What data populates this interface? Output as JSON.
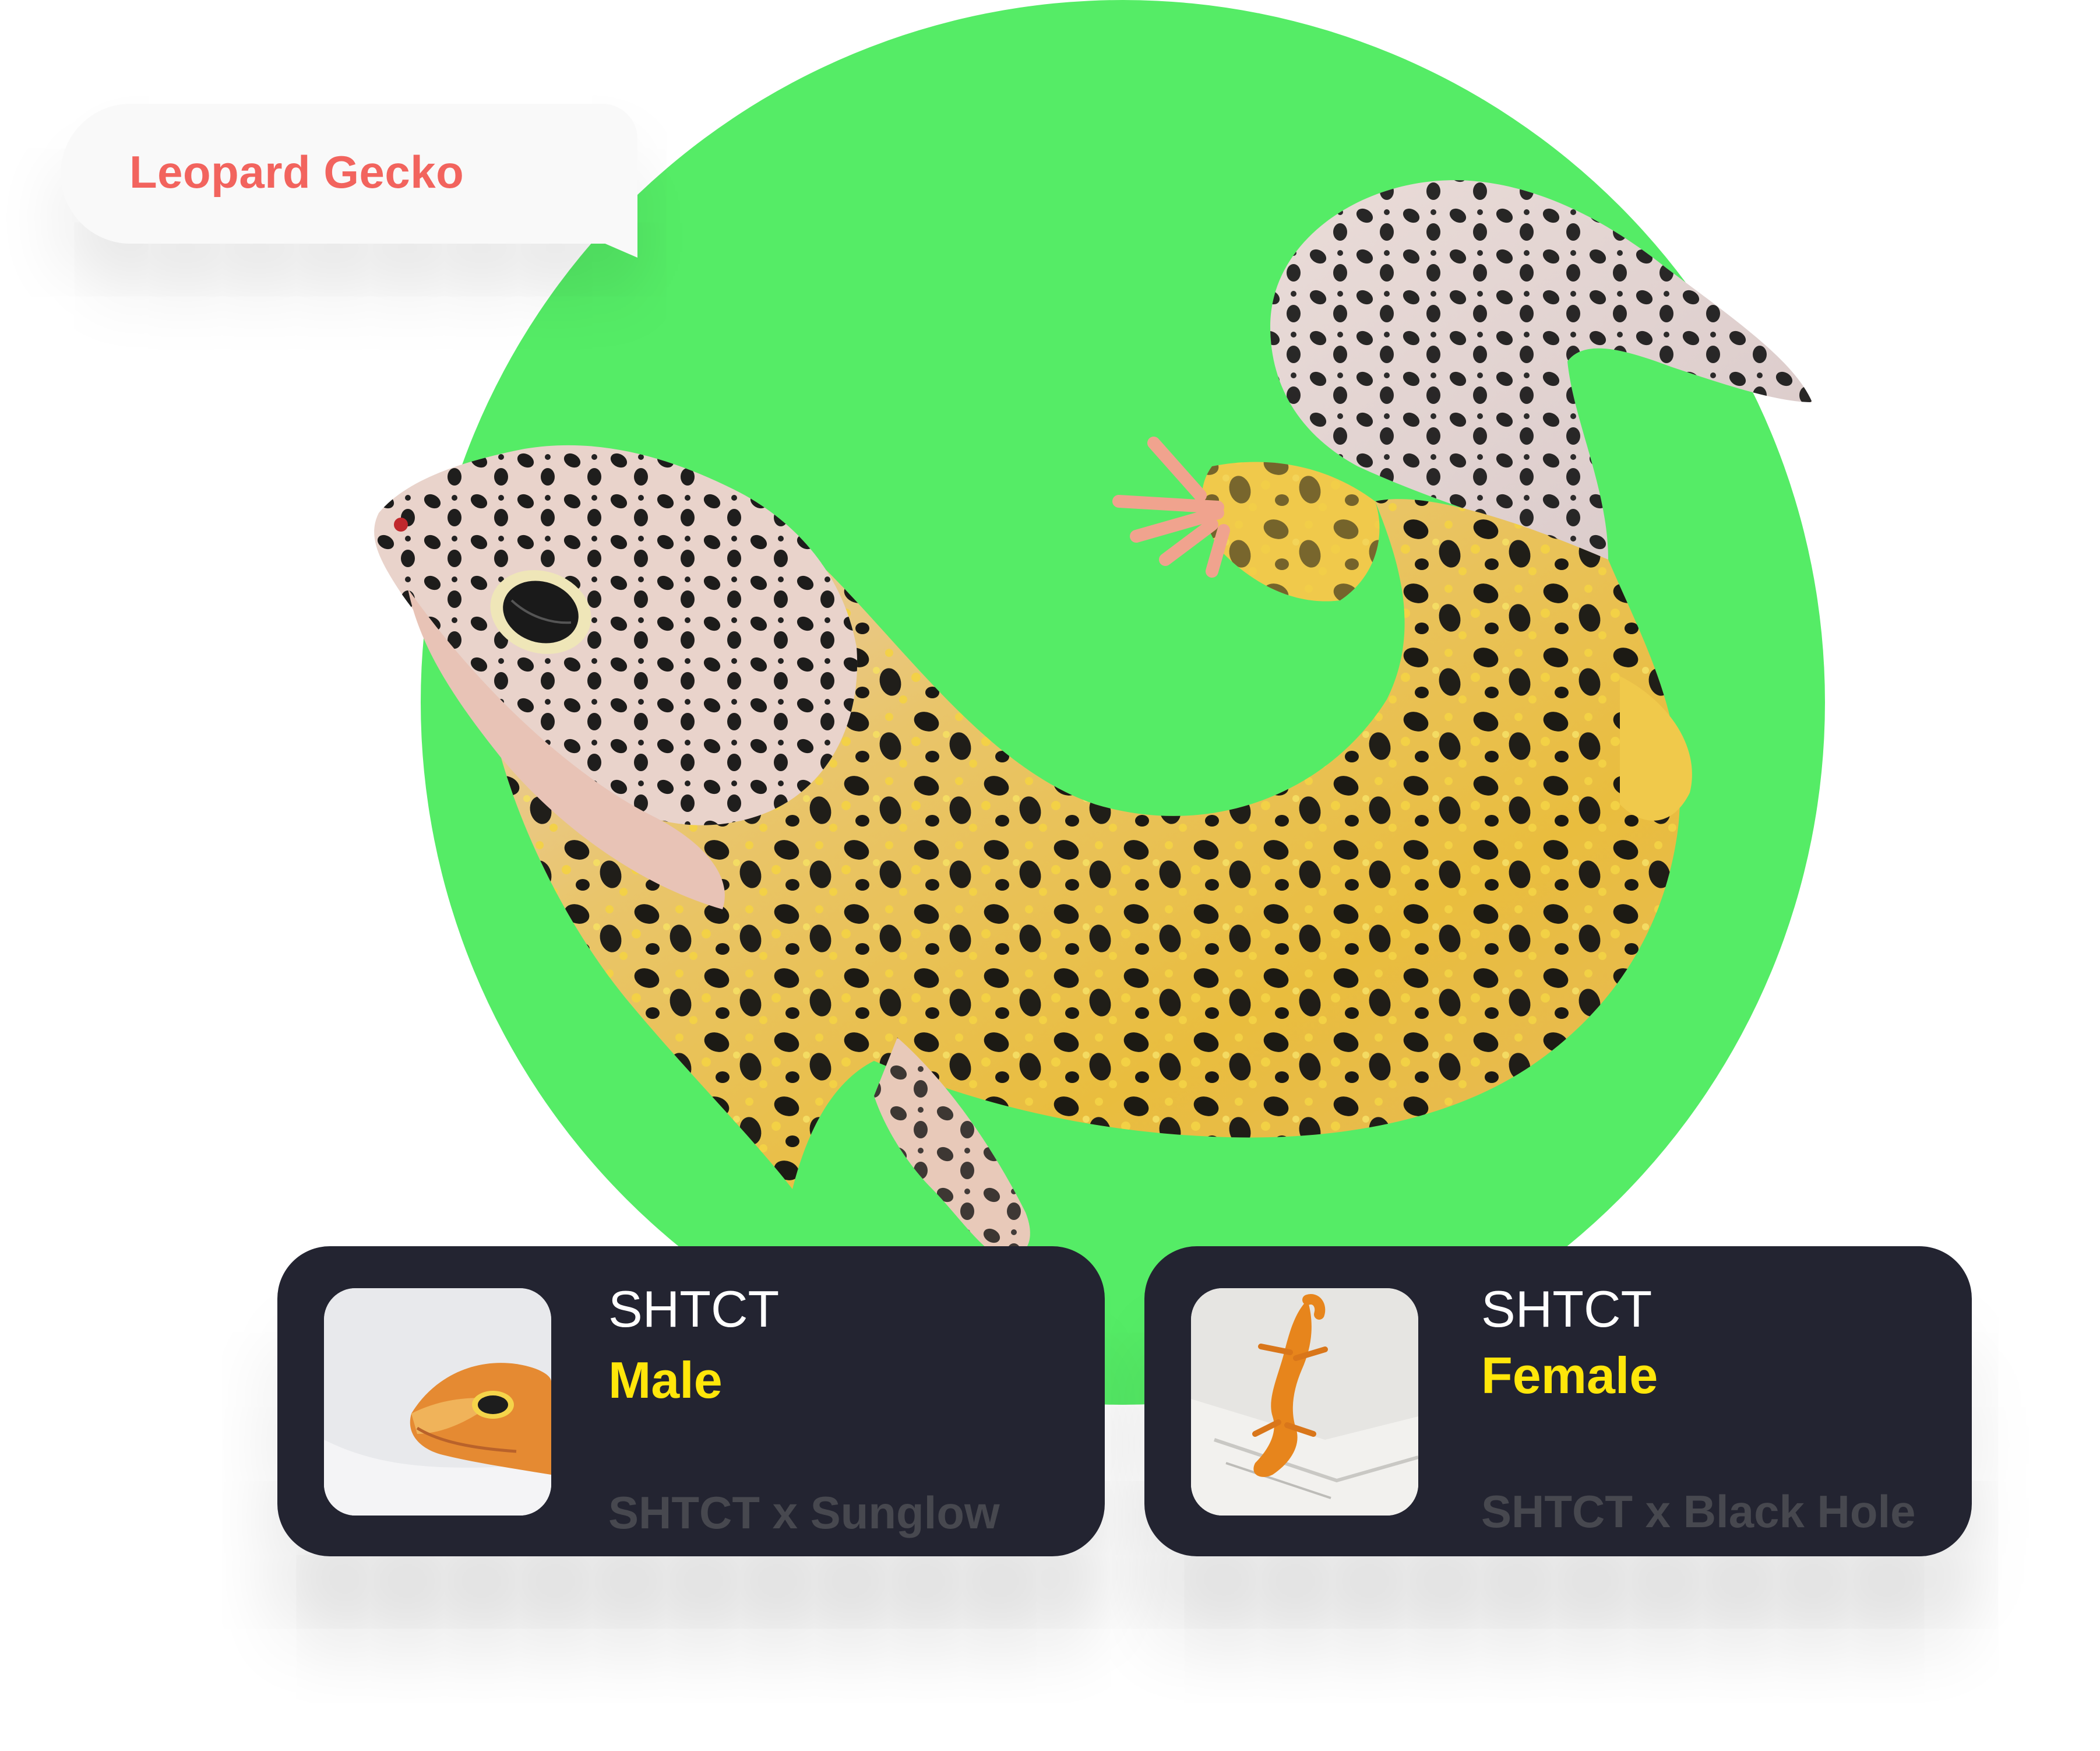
{
  "species": {
    "label": "Leopard Gecko"
  },
  "colors": {
    "background": "#ffffff",
    "circle": "#55ec66",
    "card": "#232431",
    "species_text": "#f2645e",
    "sex_text": "#ffe60a",
    "lineage_text": "#47484f"
  },
  "hero_image": {
    "subject": "leopard-gecko-illustration"
  },
  "cards": [
    {
      "thumbnail": "orange-gecko-head-photo",
      "morph": "SHTCT",
      "sex": "Male",
      "lineage": "SHTCT x Sunglow"
    },
    {
      "thumbnail": "orange-gecko-on-paper-photo",
      "morph": "SHTCT",
      "sex": "Female",
      "lineage": "SHTCT x Black Hole"
    }
  ]
}
